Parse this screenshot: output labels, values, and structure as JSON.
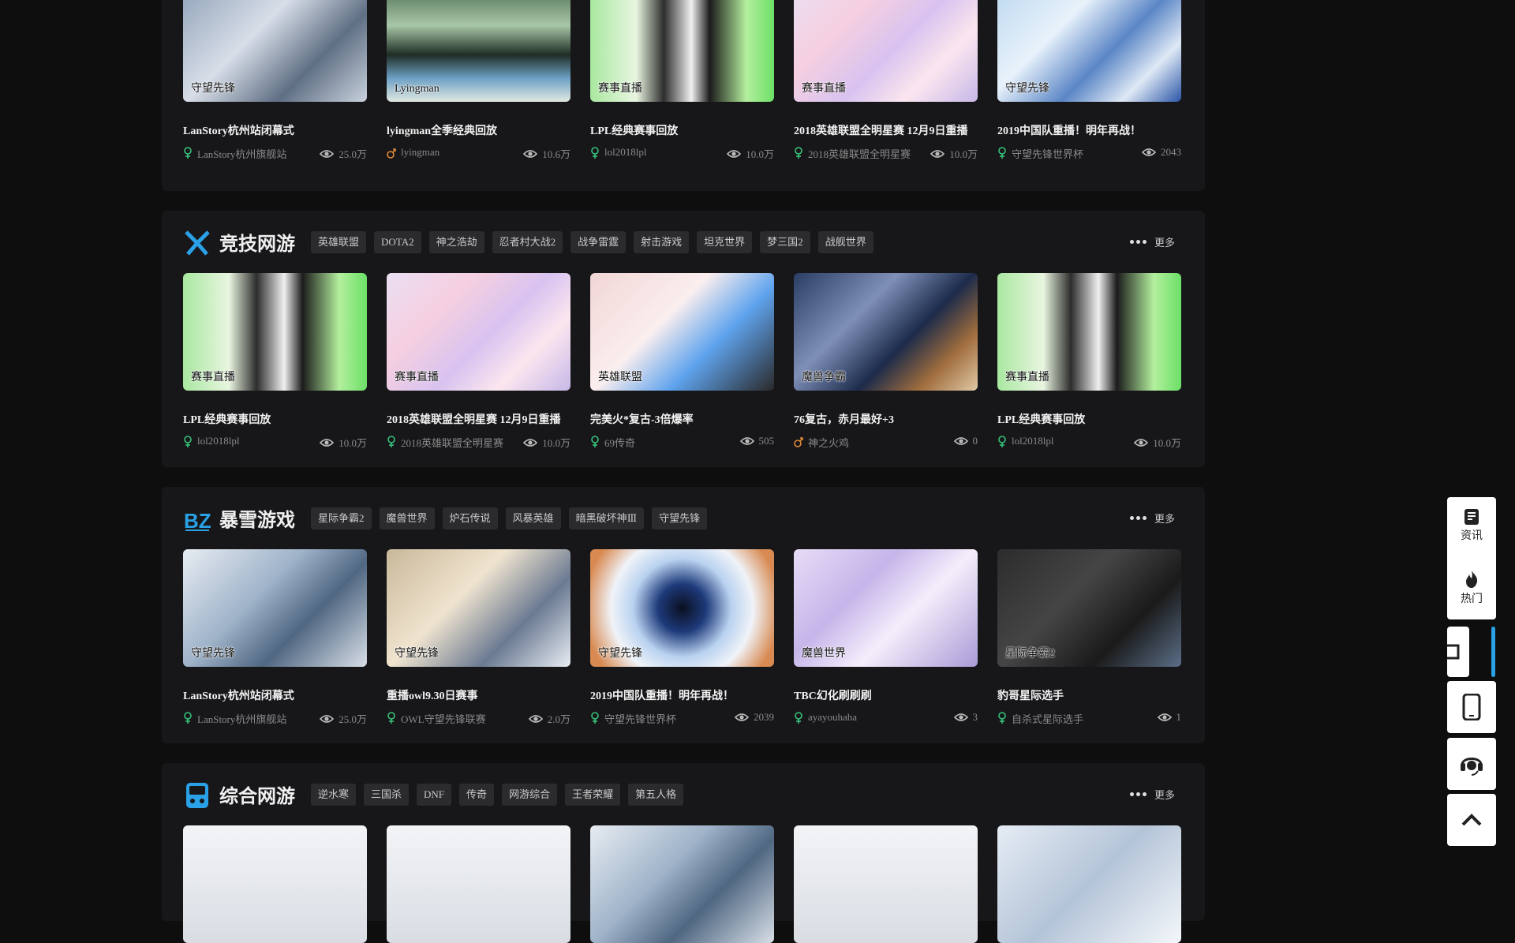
{
  "top_row": [
    {
      "label": "守望先锋",
      "title": "LanStory杭州站闭幕式",
      "author": "LanStory杭州旗舰站",
      "views": "25.0万",
      "art": "g-blue",
      "author_icon": "female"
    },
    {
      "label": "Lyingman",
      "title": "lyingman全季经典回放",
      "author": "lyingman",
      "views": "10.6万",
      "art": "g-lyn",
      "author_icon": "male"
    },
    {
      "label": "赛事直播",
      "title": "LPL经典赛事回放",
      "author": "lol2018lpl",
      "views": "10.0万",
      "art": "g-green",
      "author_icon": "female"
    },
    {
      "label": "赛事直播",
      "title": "2018英雄联盟全明星赛 12月9日重播",
      "author": "2018英雄联盟全明星赛",
      "views": "10.0万",
      "art": "g-pink",
      "author_icon": "female"
    },
    {
      "label": "守望先锋",
      "title": "2019中国队重播！明年再战！",
      "author": "守望先锋世界杯",
      "views": "2043",
      "art": "g-ice",
      "author_icon": "female"
    }
  ],
  "sections": [
    {
      "title": "竞技网游",
      "icon": "crossed-swords-icon",
      "more": "更多",
      "tags": [
        "英雄联盟",
        "DOTA2",
        "神之浩劫",
        "忍者村大战2",
        "战争雷霆",
        "射击游戏",
        "坦克世界",
        "梦三国2",
        "战舰世界"
      ],
      "cards": [
        {
          "label": "赛事直播",
          "title": "LPL经典赛事回放",
          "author": "lol2018lpl",
          "views": "10.0万",
          "art": "g-green",
          "author_icon": "female"
        },
        {
          "label": "赛事直播",
          "title": "2018英雄联盟全明星赛 12月9日重播",
          "author": "2018英雄联盟全明星赛",
          "views": "10.0万",
          "art": "g-pink",
          "author_icon": "female"
        },
        {
          "label": "英雄联盟",
          "title": "完美火*复古-3倍爆率",
          "author": "69传奇",
          "views": "505",
          "art": "g-red",
          "author_icon": "female"
        },
        {
          "label": "魔兽争霸",
          "title": "76复古，赤月最好+3",
          "author": "神之火鸡",
          "views": "0",
          "art": "g-navy",
          "author_icon": "male"
        },
        {
          "label": "赛事直播",
          "title": "LPL经典赛事回放",
          "author": "lol2018lpl",
          "views": "10.0万",
          "art": "g-green",
          "author_icon": "female"
        }
      ]
    },
    {
      "title": "暴雪游戏",
      "icon": "blizzard-icon",
      "more": "更多",
      "tags": [
        "星际争霸2",
        "魔兽世界",
        "炉石传说",
        "风暴英雄",
        "暗黑破坏神Ⅲ",
        "守望先锋"
      ],
      "cards": [
        {
          "label": "守望先锋",
          "title": "LanStory杭州站闭幕式",
          "author": "LanStory杭州旗舰站",
          "views": "25.0万",
          "art": "g-grey",
          "author_icon": "female"
        },
        {
          "label": "守望先锋",
          "title": "重播owl9.30日赛事",
          "author": "OWL守望先锋联赛",
          "views": "2.0万",
          "art": "g-amber",
          "author_icon": "female"
        },
        {
          "label": "守望先锋",
          "title": "2019中国队重播！明年再战！",
          "author": "守望先锋世界杯",
          "views": "2039",
          "art": "g-orb",
          "author_icon": "female"
        },
        {
          "label": "魔兽世界",
          "title": "TBC幻化刷刷刷",
          "author": "ayayouhaha",
          "views": "3",
          "art": "g-lav",
          "author_icon": "female"
        },
        {
          "label": "星际争霸2",
          "title": "豹哥星际选手",
          "author": "自杀式星际选手",
          "views": "1",
          "art": "g-dark",
          "author_icon": "female"
        }
      ]
    },
    {
      "title": "综合网游",
      "icon": "gamepad-icon",
      "more": "更多",
      "tags": [
        "逆水寒",
        "三国杀",
        "DNF",
        "传奇",
        "网游综合",
        "王者荣耀",
        "第五人格"
      ],
      "cards": [
        {
          "art": "g-white"
        },
        {
          "art": "g-white"
        },
        {
          "art": "g-grey"
        },
        {
          "art": "g-white"
        },
        {
          "art": "g-snow"
        }
      ]
    }
  ],
  "sidebar": {
    "news_label": "资讯",
    "hot_label": "热门"
  },
  "colors": {
    "page_bg": "#0e0e0f",
    "section_bg": "#17171a",
    "tag_bg": "#2b2b2e",
    "accent": "#2aa1e6",
    "author_female": "#37c27a",
    "author_male": "#e0883a"
  }
}
